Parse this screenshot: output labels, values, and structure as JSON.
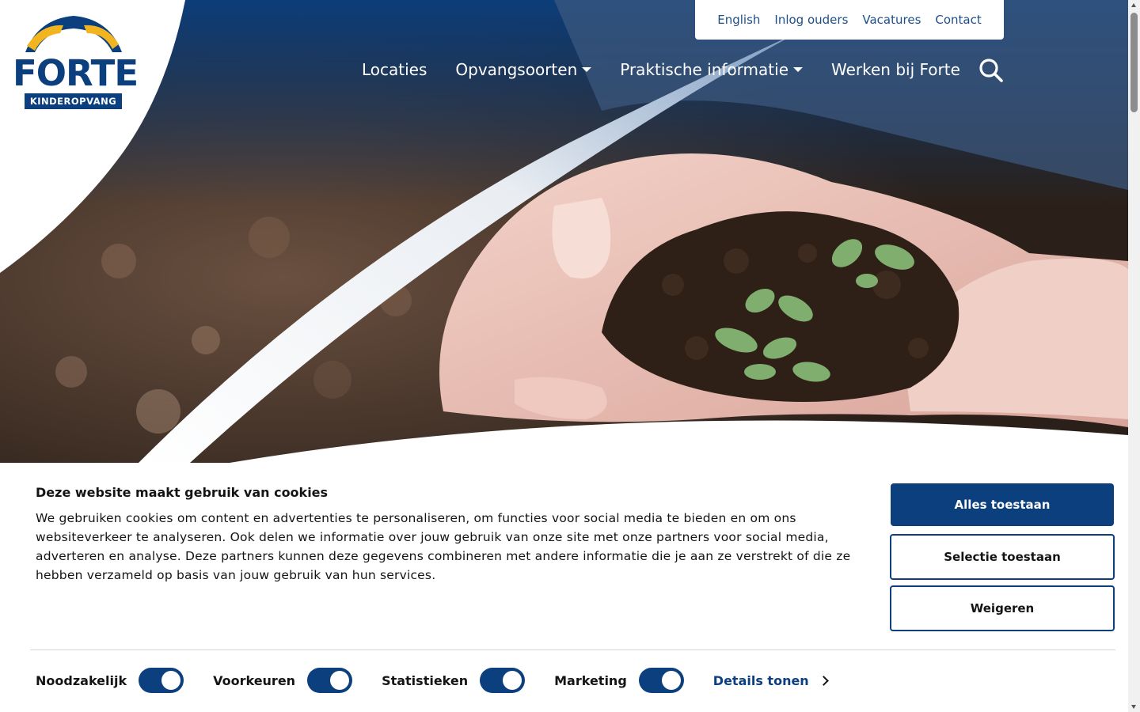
{
  "brand": {
    "logo_word": "FORTE",
    "logo_sub": "KINDEROPVANG",
    "colors": {
      "navy": "#0b3f7e",
      "yellow": "#f2b51f",
      "link": "#1d4f87"
    }
  },
  "toplinks": [
    "English",
    "Inlog ouders",
    "Vacatures",
    "Contact"
  ],
  "nav": {
    "items": [
      {
        "label": "Locaties",
        "dropdown": false
      },
      {
        "label": "Opvangsoorten",
        "dropdown": true
      },
      {
        "label": "Praktische informatie",
        "dropdown": true
      },
      {
        "label": "Werken bij Forte",
        "dropdown": false
      }
    ],
    "search_icon": "search-icon"
  },
  "cookie": {
    "title": "Deze website maakt gebruik van cookies",
    "text": "We gebruiken cookies om content en advertenties te personaliseren, om functies voor social media te bieden en om ons websiteverkeer te analyseren. Ook delen we informatie over jouw gebruik van onze site met onze partners voor social media, adverteren en analyse. Deze partners kunnen deze gegevens combineren met andere informatie die je aan ze verstrekt of die ze hebben verzameld op basis van jouw gebruik van hun services.",
    "buttons": {
      "allow_all": "Alles toestaan",
      "allow_selection": "Selectie toestaan",
      "deny": "Weigeren"
    },
    "toggles": [
      {
        "label": "Noodzakelijk",
        "on": true
      },
      {
        "label": "Voorkeuren",
        "on": true
      },
      {
        "label": "Statistieken",
        "on": true
      },
      {
        "label": "Marketing",
        "on": true
      }
    ],
    "details_label": "Details tonen"
  }
}
